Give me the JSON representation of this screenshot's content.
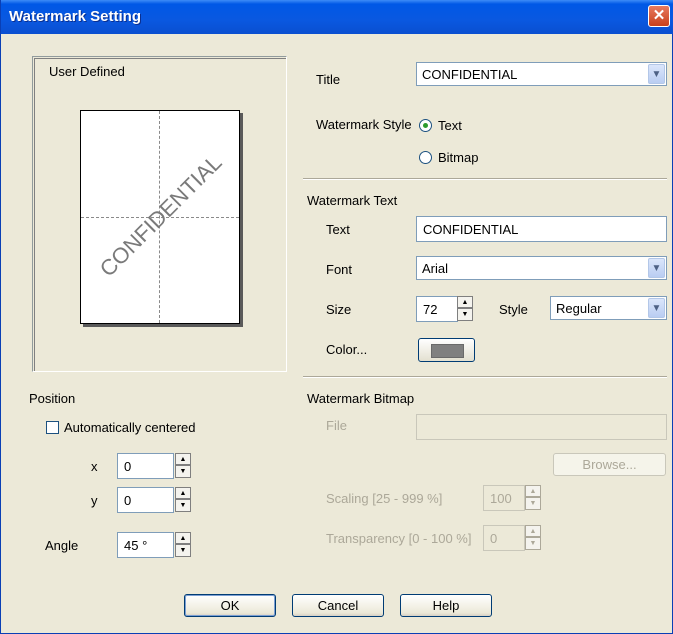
{
  "window": {
    "title": "Watermark Setting",
    "close_glyph": "✕"
  },
  "preview": {
    "heading": "User Defined",
    "watermark_text": "CONFIDENTIAL"
  },
  "title_field": {
    "label": "Title",
    "value": "CONFIDENTIAL"
  },
  "watermark_style": {
    "label": "Watermark Style",
    "options": [
      {
        "label": "Text",
        "selected": true
      },
      {
        "label": "Bitmap",
        "selected": false
      }
    ]
  },
  "watermark_text": {
    "group_label": "Watermark Text",
    "text_label": "Text",
    "text_value": "CONFIDENTIAL",
    "font_label": "Font",
    "font_value": "Arial",
    "size_label": "Size",
    "size_value": "72",
    "style_label": "Style",
    "style_value": "Regular",
    "color_label": "Color...",
    "color_value": "#808080"
  },
  "watermark_bitmap": {
    "group_label": "Watermark Bitmap",
    "file_label": "File",
    "file_value": "",
    "browse_label": "Browse...",
    "scaling_label": "Scaling [25 - 999 %]",
    "scaling_value": "100",
    "transparency_label": "Transparency [0 - 100 %]",
    "transparency_value": "0"
  },
  "position": {
    "group_label": "Position",
    "auto_center_label": "Automatically centered",
    "auto_center_checked": false,
    "x_label": "x",
    "x_value": "0",
    "y_label": "y",
    "y_value": "0",
    "angle_label": "Angle",
    "angle_value": "45 °"
  },
  "buttons": {
    "ok": "OK",
    "cancel": "Cancel",
    "help": "Help"
  },
  "icons": {
    "dropdown_arrow": "chevron-down-icon",
    "spin_up": "spin-up-icon",
    "spin_down": "spin-down-icon"
  }
}
